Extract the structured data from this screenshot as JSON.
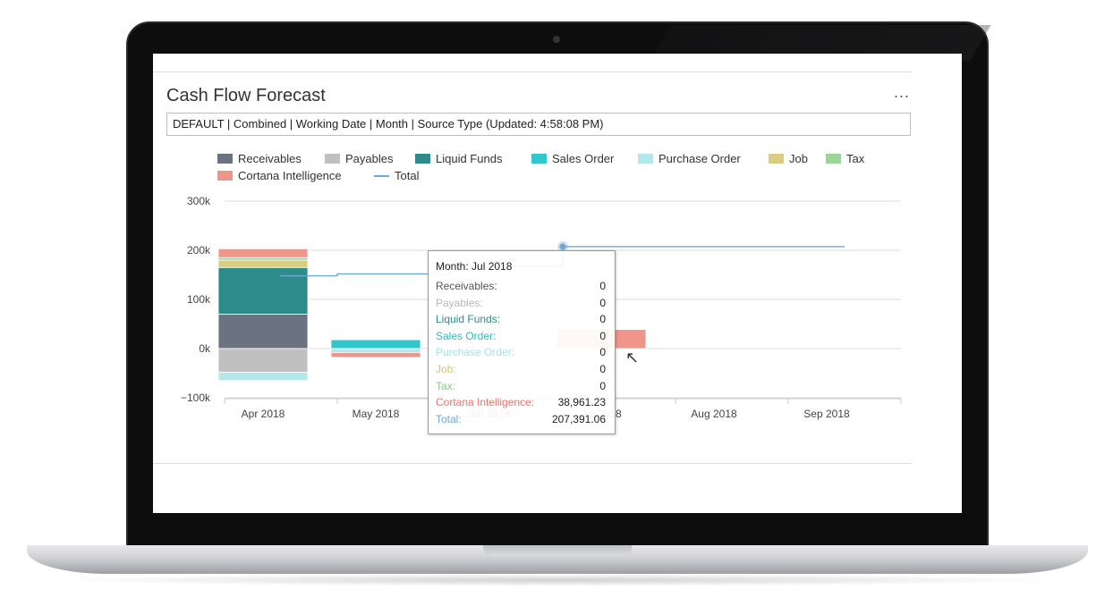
{
  "widget": {
    "title": "Cash Flow Forecast",
    "more_label": "...",
    "filter_text": "DEFAULT | Combined | Working Date | Month | Source Type (Updated:  4:58:08 PM)"
  },
  "legend": [
    {
      "label": "Receivables",
      "color": "#6b7280",
      "kind": "box"
    },
    {
      "label": "Payables",
      "color": "#c0c0c0",
      "kind": "box"
    },
    {
      "label": "Liquid Funds",
      "color": "#2e8b8b",
      "kind": "box"
    },
    {
      "label": "Sales Order",
      "color": "#33c6cc",
      "kind": "box"
    },
    {
      "label": "Purchase Order",
      "color": "#b2e8ea",
      "kind": "box"
    },
    {
      "label": "Job",
      "color": "#d9cd82",
      "kind": "box"
    },
    {
      "label": "Tax",
      "color": "#99d699",
      "kind": "box"
    },
    {
      "label": "Cortana Intelligence",
      "color": "#f0958a",
      "kind": "box"
    },
    {
      "label": "Total",
      "color": "#6fa8d1",
      "kind": "line"
    }
  ],
  "chart_data": {
    "type": "bar",
    "categories": [
      "Apr 2018",
      "May 2018",
      "Jun 2018",
      "Jul 2018",
      "Aug 2018",
      "Sep 2018"
    ],
    "y_ticks": [
      "300k",
      "200k",
      "100k",
      "0k",
      "−100k"
    ],
    "ylim": [
      -100000,
      300000
    ],
    "grid": true,
    "legend_position": "top",
    "series": [
      {
        "name": "Receivables",
        "color": "#6b7280",
        "values": [
          70000,
          0,
          0,
          0,
          0,
          0
        ]
      },
      {
        "name": "Payables",
        "color": "#c0c0c0",
        "values": [
          -48000,
          0,
          0,
          0,
          0,
          0
        ]
      },
      {
        "name": "Liquid Funds",
        "color": "#2e8b8b",
        "values": [
          95000,
          0,
          0,
          0,
          0,
          0
        ]
      },
      {
        "name": "Sales Order",
        "color": "#33c6cc",
        "values": [
          0,
          18000,
          0,
          0,
          0,
          0
        ]
      },
      {
        "name": "Purchase Order",
        "color": "#b2e8ea",
        "values": [
          -17000,
          -8000,
          0,
          0,
          0,
          0
        ]
      },
      {
        "name": "Job",
        "color": "#d9cd82",
        "values": [
          15000,
          0,
          0,
          0,
          0,
          0
        ]
      },
      {
        "name": "Tax",
        "color": "#99d699",
        "values": [
          5000,
          0,
          0,
          0,
          0,
          0
        ]
      },
      {
        "name": "Cortana Intelligence",
        "color": "#f0958a",
        "values": [
          18000,
          -10000,
          0,
          38961.23,
          0,
          0
        ]
      }
    ],
    "total_line": {
      "name": "Total",
      "color": "#6fa8d1",
      "values": [
        148000,
        152000,
        168000,
        207391.06,
        207391.06,
        207391.06
      ]
    }
  },
  "tooltip": {
    "title": "Month: Jul 2018",
    "rows": [
      {
        "label": "Receivables:",
        "value": "0",
        "color": "#555555"
      },
      {
        "label": "Payables:",
        "value": "0",
        "color": "#b8b8b8"
      },
      {
        "label": "Liquid Funds:",
        "value": "0",
        "color": "#2e8b8b"
      },
      {
        "label": "Sales Order:",
        "value": "0",
        "color": "#33b8c0"
      },
      {
        "label": "Purchase Order:",
        "value": "0",
        "color": "#a8e0e2"
      },
      {
        "label": "Job:",
        "value": "0",
        "color": "#d2c47a"
      },
      {
        "label": "Tax:",
        "value": "0",
        "color": "#8cc88c"
      },
      {
        "label": "Cortana Intelligence:",
        "value": "38,961.23",
        "color": "#e8756a"
      },
      {
        "label": "Total:",
        "value": "207,391.06",
        "color": "#6fa8d1"
      }
    ]
  }
}
